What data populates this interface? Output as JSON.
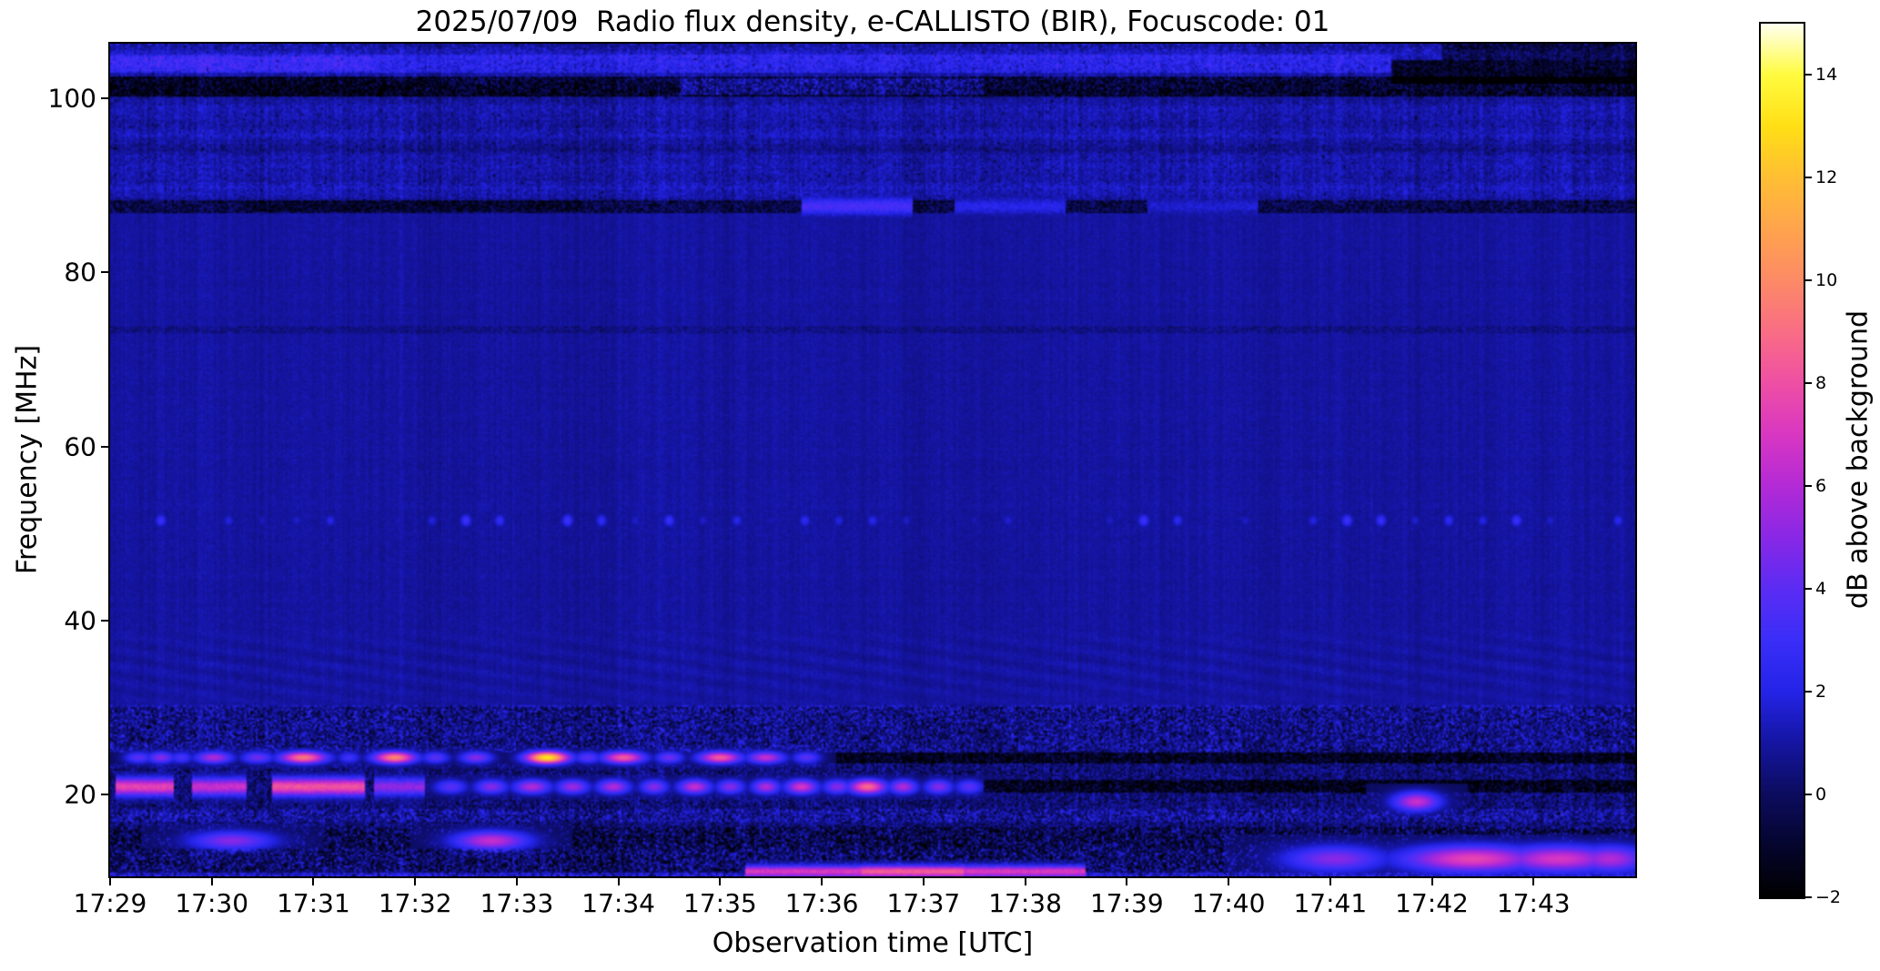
{
  "chart_data": {
    "type": "heatmap",
    "subtype": "solar-radio-spectrogram",
    "title": "2025/07/09  Radio flux density, e-CALLISTO (BIR), Focuscode: 01",
    "date": "2025/07/09",
    "instrument": "e-CALLISTO (BIR)",
    "focuscode": "01",
    "duration_min": 15,
    "x_axis": {
      "label": "Observation time [UTC]",
      "tick_minutes": [
        0,
        1,
        2,
        3,
        4,
        5,
        6,
        7,
        8,
        9,
        10,
        11,
        12,
        13,
        14
      ],
      "tick_labels": [
        "17:29",
        "17:30",
        "17:31",
        "17:32",
        "17:33",
        "17:34",
        "17:35",
        "17:36",
        "17:37",
        "17:38",
        "17:39",
        "17:40",
        "17:41",
        "17:42",
        "17:43"
      ],
      "range_utc": [
        "17:29",
        "17:44"
      ]
    },
    "y_axis": {
      "label": "Frequency [MHz]",
      "lim": [
        10.6,
        106.3
      ],
      "tick_values": [
        20,
        40,
        60,
        80,
        100
      ],
      "tick_labels": [
        "20",
        "40",
        "60",
        "80",
        "100"
      ]
    },
    "colorbar": {
      "label": "dB above background",
      "lim": [
        -2,
        15
      ],
      "tick_values": [
        -2,
        0,
        2,
        4,
        6,
        8,
        10,
        12,
        14
      ],
      "tick_labels": [
        "−2",
        "0",
        "2",
        "4",
        "6",
        "8",
        "10",
        "12",
        "14"
      ],
      "colormap_name": "gnuplot2-like",
      "stops": [
        [
          -2,
          "#000000"
        ],
        [
          -1,
          "#05052e"
        ],
        [
          0,
          "#0c0c5e"
        ],
        [
          1,
          "#1515a2"
        ],
        [
          2,
          "#2424e8"
        ],
        [
          3,
          "#3a2ef8"
        ],
        [
          4,
          "#5b2cf3"
        ],
        [
          5,
          "#8928e6"
        ],
        [
          6,
          "#b32ad6"
        ],
        [
          7,
          "#d837c2"
        ],
        [
          8,
          "#ee4fa4"
        ],
        [
          9,
          "#f96d85"
        ],
        [
          10,
          "#fc8a66"
        ],
        [
          11,
          "#ffa44d"
        ],
        [
          12,
          "#ffbe34"
        ],
        [
          13,
          "#ffdf16"
        ],
        [
          14,
          "#fffb3f"
        ],
        [
          15,
          "#fffff0"
        ]
      ]
    },
    "background_regions": [
      {
        "name": "fm-broadcast-band",
        "f": [
          88,
          106.3
        ],
        "base_db": 1.05,
        "noise_db": 0.55,
        "row_texture": 0.5,
        "col_texture": 0.55,
        "dark_mottle_p": 0.04
      },
      {
        "name": "quiet-mid-band",
        "f": [
          30,
          88
        ],
        "base_db": 0.95,
        "noise_db": 0.22,
        "row_texture": 0.1,
        "col_texture": 0.28,
        "dark_mottle_p": 0.0
      },
      {
        "name": "hf-rfi-band",
        "f": [
          10.6,
          30
        ],
        "base_db": 0.45,
        "noise_db": 1.0,
        "row_texture": 0.1,
        "col_texture": 0.55,
        "dark_mottle_p": 0.18
      }
    ],
    "features": [
      {
        "name": "top-edge-speckle-106MHz",
        "type": "speckle",
        "f": [
          105.3,
          106.3
        ],
        "m": [
          0,
          15
        ],
        "p": 0.5,
        "lo": -1.6,
        "hi": 2.6
      },
      {
        "name": "bright-blue-band-104MHz",
        "type": "hband",
        "f": [
          102.9,
          105.0
        ],
        "m": [
          0,
          12.6
        ],
        "add": 1.0,
        "noise": 0.7
      },
      {
        "name": "bright-blue-band-104MHz-early-boost",
        "type": "hband",
        "f": [
          103.1,
          104.9
        ],
        "m": [
          0,
          2.6
        ],
        "add": 0.7,
        "noise": 0.4
      },
      {
        "name": "dark-band-101MHz",
        "type": "hband",
        "f": [
          100.3,
          102.5
        ],
        "m": [
          0,
          15
        ],
        "add": -1.9,
        "noise": 1.3
      },
      {
        "name": "dark-band-101MHz-left-boost",
        "type": "hband",
        "f": [
          100.2,
          102.6
        ],
        "m": [
          0,
          3.1
        ],
        "add": -0.5,
        "noise": 0.3
      },
      {
        "name": "blue-patch-101MHz-mid",
        "type": "hband",
        "f": [
          100.4,
          102.3
        ],
        "m": [
          5.6,
          8.6
        ],
        "add": 1.5,
        "noise": 0.5
      },
      {
        "name": "dark-band-103MHz-right",
        "type": "hband",
        "f": [
          101.6,
          104.4
        ],
        "m": [
          12.6,
          15
        ],
        "add": -2.2,
        "noise": 0.9
      },
      {
        "name": "dark-corner-top-right",
        "type": "hband",
        "f": [
          104.4,
          106.3
        ],
        "m": [
          13.1,
          15
        ],
        "add": -1.6,
        "noise": 0.8
      },
      {
        "name": "dark-line-87.5MHz",
        "type": "hband",
        "f": [
          86.9,
          88.3
        ],
        "m": [
          0,
          15
        ],
        "add": -1.4,
        "noise": 1.1
      },
      {
        "name": "dark-line-87.5MHz-left-boost",
        "type": "hband",
        "f": [
          87.0,
          88.2
        ],
        "m": [
          1.3,
          4.6
        ],
        "add": -0.5,
        "noise": 0.3
      },
      {
        "name": "blue-streaks-87.5MHz",
        "type": "hseg",
        "f": 87.6,
        "df": 0.8,
        "items": [
          [
            6.8,
            7.9,
            3.4
          ],
          [
            8.3,
            9.4,
            2.2
          ],
          [
            10.2,
            11.3,
            1.7
          ]
        ]
      },
      {
        "name": "faint-dark-line-73MHz",
        "type": "hband",
        "f": [
          72.9,
          73.8
        ],
        "m": [
          0,
          15
        ],
        "add": -0.4,
        "noise": 0.45
      },
      {
        "name": "periodic-dots-51.5MHz",
        "type": "dots",
        "f": 51.5,
        "df": 0.55,
        "period_s": 20,
        "width_s": 2.5,
        "amp": [
          0.4,
          3.2
        ]
      },
      {
        "name": "interference-ripples-30-40MHz",
        "type": "wave",
        "f": [
          29.0,
          40.0
        ],
        "amp": 0.18,
        "period_min": 1.05,
        "slope": 0.55
      },
      {
        "name": "noise-band-25-30MHz",
        "type": "hband",
        "f": [
          24.8,
          30.2
        ],
        "m": [
          0,
          15
        ],
        "add": 0.25,
        "noise": 1.1
      },
      {
        "name": "dark-lane-24MHz",
        "type": "hband",
        "f": [
          23.6,
          24.9
        ],
        "m": [
          0,
          15
        ],
        "add": -1.7,
        "noise": 0.8
      },
      {
        "name": "beacon-blobs-24.2MHz",
        "type": "blobs",
        "f": 24.25,
        "df": 0.5,
        "items": [
          [
            0.28,
            4,
            6
          ],
          [
            0.5,
            5,
            6
          ],
          [
            0.7,
            3.5,
            5
          ],
          [
            1.02,
            6,
            8
          ],
          [
            1.45,
            4.5,
            7
          ],
          [
            1.9,
            9.5,
            10
          ],
          [
            2.35,
            3.2,
            5
          ],
          [
            2.8,
            10,
            9
          ],
          [
            3.2,
            4,
            6
          ],
          [
            3.6,
            5,
            7
          ],
          [
            4.3,
            13.5,
            9
          ],
          [
            4.7,
            4,
            6
          ],
          [
            5.05,
            8.5,
            9
          ],
          [
            5.5,
            4.5,
            6
          ],
          [
            6.0,
            8.5,
            9
          ],
          [
            6.45,
            6.5,
            8
          ],
          [
            6.85,
            4,
            6
          ]
        ]
      },
      {
        "name": "pink-segments-21MHz",
        "type": "hseg",
        "f": 20.9,
        "df": 0.75,
        "items": [
          [
            0.05,
            0.62,
            7.6
          ],
          [
            0.8,
            1.35,
            6.6
          ],
          [
            1.6,
            2.5,
            8.2
          ],
          [
            2.6,
            3.1,
            5.2
          ]
        ]
      },
      {
        "name": "blobs-21MHz",
        "type": "blobs",
        "f": 20.9,
        "df": 0.6,
        "items": [
          [
            3.35,
            4,
            7
          ],
          [
            3.75,
            5,
            7
          ],
          [
            4.15,
            6,
            8
          ],
          [
            4.55,
            5.5,
            7
          ],
          [
            4.95,
            6,
            7
          ],
          [
            5.35,
            5,
            6
          ],
          [
            5.75,
            6.5,
            7
          ],
          [
            6.1,
            5,
            6
          ],
          [
            6.45,
            6,
            6
          ],
          [
            6.8,
            7,
            7
          ],
          [
            7.15,
            5,
            6
          ],
          [
            7.45,
            9,
            8
          ],
          [
            7.8,
            6,
            6
          ],
          [
            8.15,
            5,
            6
          ],
          [
            8.45,
            4,
            6
          ]
        ]
      },
      {
        "name": "dark-lane-21MHz-right",
        "type": "hband",
        "f": [
          20.2,
          21.6
        ],
        "m": [
          8.6,
          15
        ],
        "add": -1.8,
        "noise": 1.0
      },
      {
        "name": "blue-dash-row-17.5MHz",
        "type": "hband",
        "f": [
          16.8,
          18.4
        ],
        "m": [
          0,
          15
        ],
        "add": 0.55,
        "noise": 1.0
      },
      {
        "name": "dark-mottle-14-16MHz",
        "type": "hband",
        "f": [
          13.8,
          16.3
        ],
        "m": [
          0,
          15
        ],
        "add": -0.7,
        "noise": 1.5
      },
      {
        "name": "magenta-patches-14.8MHz",
        "type": "blobs",
        "f": 14.7,
        "df": 0.8,
        "items": [
          [
            1.2,
            5,
            18
          ],
          [
            3.75,
            6.5,
            16
          ]
        ]
      },
      {
        "name": "mottle-11-13MHz",
        "type": "hband",
        "f": [
          11.2,
          13.8
        ],
        "m": [
          0,
          15
        ],
        "add": -0.3,
        "noise": 1.6
      },
      {
        "name": "pink-line-11MHz",
        "type": "hseg",
        "f": 11.15,
        "df": 0.5,
        "items": [
          [
            6.25,
            9.6,
            7.2
          ],
          [
            7.4,
            8.4,
            8.6
          ]
        ]
      },
      {
        "name": "magenta-patches-right-12-13MHz",
        "type": "blobs",
        "f": 12.6,
        "df": 1.1,
        "items": [
          [
            12.05,
            5,
            22
          ],
          [
            13.4,
            7.6,
            30
          ],
          [
            14.25,
            7,
            26
          ],
          [
            14.75,
            6,
            16
          ]
        ]
      },
      {
        "name": "magenta-blob-19MHz",
        "type": "blobs",
        "f": 19.2,
        "df": 0.8,
        "items": [
          [
            12.85,
            6.6,
            10
          ]
        ]
      },
      {
        "name": "bright-bottom-row-10.7MHz",
        "type": "speckle",
        "f": [
          10.6,
          11.1
        ],
        "m": [
          0,
          15
        ],
        "p": 0.8,
        "lo": 0.6,
        "hi": 3.0
      }
    ]
  }
}
